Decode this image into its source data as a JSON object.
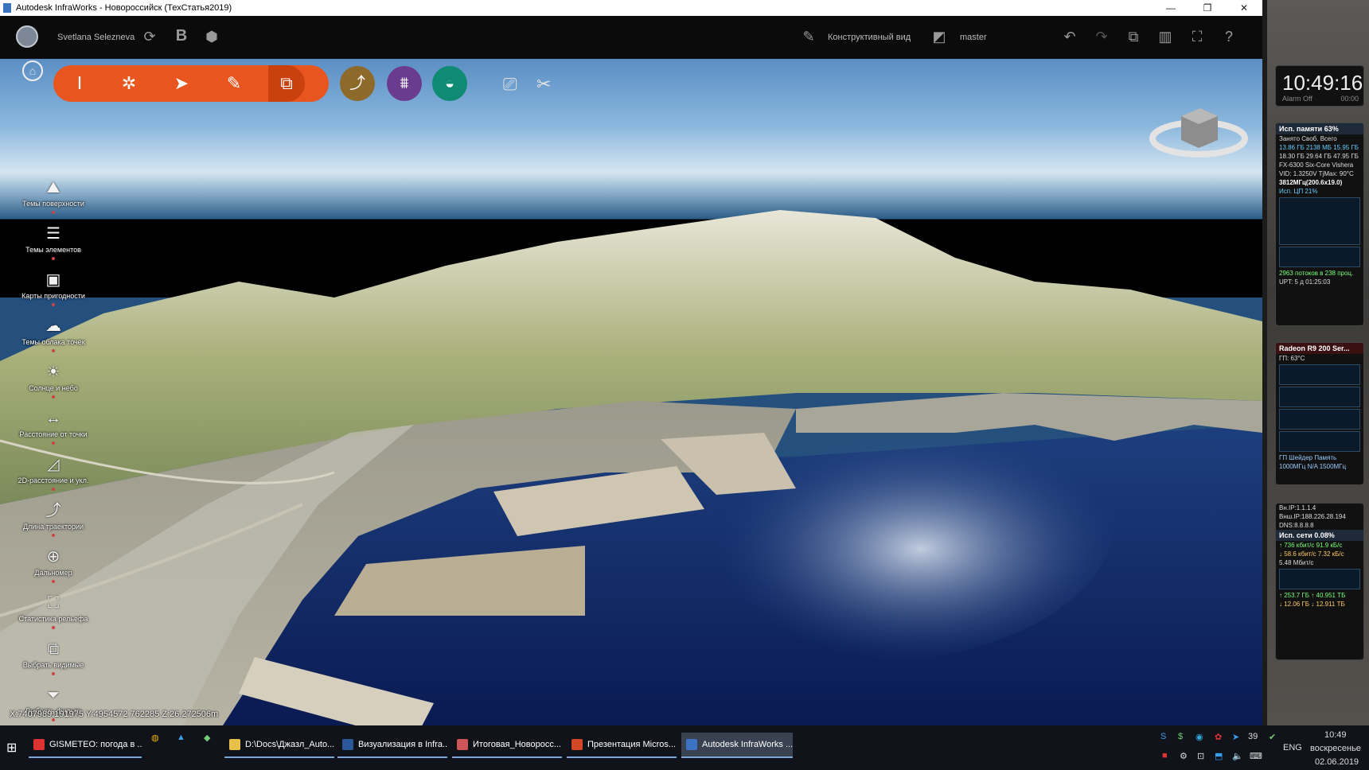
{
  "window": {
    "title": "Autodesk InfraWorks - Новороссийск (ТехСтатья2019)",
    "minimize": "—",
    "maximize": "❐",
    "close": "✕"
  },
  "appbar": {
    "user": "Svetlana Selezneva",
    "view_label": "Конструктивный вид",
    "branch": "master"
  },
  "left_panel": [
    {
      "label": "Темы поверхности",
      "icon": "mountain-icon",
      "glyph": "⛰"
    },
    {
      "label": "Темы элементов",
      "icon": "list-icon",
      "glyph": "☰"
    },
    {
      "label": "Карты пригодности",
      "icon": "map-icon",
      "glyph": "▣"
    },
    {
      "label": "Темы облака точек",
      "icon": "cloud-points-icon",
      "glyph": "☁"
    },
    {
      "label": "Солнце и небо",
      "icon": "sun-icon",
      "glyph": "☀"
    },
    {
      "label": "Расстояние от точки",
      "icon": "distance-icon",
      "glyph": "↔"
    },
    {
      "label": "2D-расстояние и укл.",
      "icon": "slope-icon",
      "glyph": "◿"
    },
    {
      "label": "Длина траектории",
      "icon": "path-icon",
      "glyph": "⤴"
    },
    {
      "label": "Дальномер",
      "icon": "rangefinder-icon",
      "glyph": "⊕"
    },
    {
      "label": "Статистика рельефа",
      "icon": "terrain-stats-icon",
      "glyph": "⛶"
    },
    {
      "label": "Выбрать видимые",
      "icon": "select-visible-icon",
      "glyph": "⧉"
    },
    {
      "label": "Выбрать фильтр",
      "icon": "filter-icon",
      "glyph": "⏷"
    }
  ],
  "coords": "X:7407989.191975 Y:4954572.762285 Z:26.272506m",
  "clock": {
    "time": "10:49:16",
    "alarm": "Alarm Off",
    "timer": "00:00"
  },
  "memory": {
    "header": "Исп. памяти  63%",
    "rows": [
      "Занято  Своб.  Всего",
      "13.86 ГБ 2138 МБ 15.95 ГБ",
      "18.30 ГБ 29.64 ГБ 47.95 ГБ",
      "FX-6300 Six-Core Vishera",
      "VID: 1.3250V TjMax: 90°C",
      "3812МГц(200.6x19.0)"
    ],
    "cpu_header": "Исп. ЦП  21%",
    "footer": "2963 потоков в 238 проц.",
    "uptime": "UPT: 5 д 01:25:03"
  },
  "gpu": {
    "header": "Radeon R9 200 Ser...",
    "temp": "ГП: 63°C",
    "labels": "ГП  Шейдер  Память",
    "values": "1000МГц  N/A  1500МГц"
  },
  "network": {
    "rows": [
      "Вн.IP:1.1.1.4",
      "Внш.IP:188.226.28.194",
      "DNS:8.8.8.8"
    ],
    "header": "Исп. сети  0.08%",
    "speeds": [
      "↑ 736 кбит/с  91.9 кБ/с",
      "↓ 58.6 кбит/с  7.32 кБ/с"
    ],
    "peak": "5.48 Мбит/с",
    "totals": [
      "↑ 253.7 ГБ  ↑ 40.951 ТБ",
      "↓ 12.06 ГБ  ↓ 12.911 ТБ"
    ]
  },
  "taskbar": {
    "items": [
      {
        "label": "GISMETEO: погода в ...",
        "color": "#d33"
      },
      {
        "label": "D:\\Docs\\Джазл_Auto...",
        "color": "#e8c04a"
      },
      {
        "label": "Визуализация в Infra...",
        "color": "#2b579a"
      },
      {
        "label": "Итоговая_Новоросс...",
        "color": "#c55"
      },
      {
        "label": "Презентация Micros...",
        "color": "#d24726"
      },
      {
        "label": "Autodesk InfraWorks ...",
        "color": "#3a74c0"
      }
    ],
    "lang": "ENG",
    "time": "10:49",
    "day": "воскресенье",
    "date": "02.06.2019",
    "tray_count": "39"
  }
}
